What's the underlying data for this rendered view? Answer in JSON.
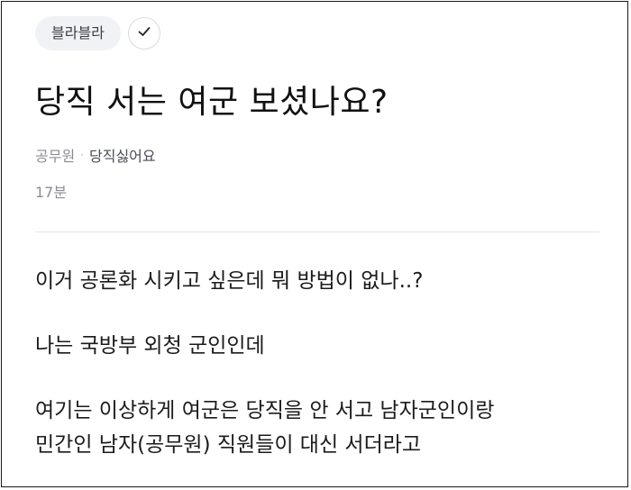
{
  "topic": {
    "label": "블라블라"
  },
  "post": {
    "title": "당직 서는 여군 보셨나요?",
    "company": "공무원",
    "nickname": "당직싫어요",
    "time": "17분",
    "paragraphs": [
      "이거 공론화 시키고 싶은데 뭐 방법이 없나..?",
      "나는 국방부 외청 군인인데",
      "여기는 이상하게 여군은 당직을 안 서고 남자군인이랑",
      "민간인 남자(공무원) 직원들이 대신 서더라고"
    ]
  },
  "icons": {
    "check": "check-icon"
  },
  "colors": {
    "chip_bg": "#f1f2f6",
    "text": "#111111",
    "meta": "#8a8d94"
  }
}
